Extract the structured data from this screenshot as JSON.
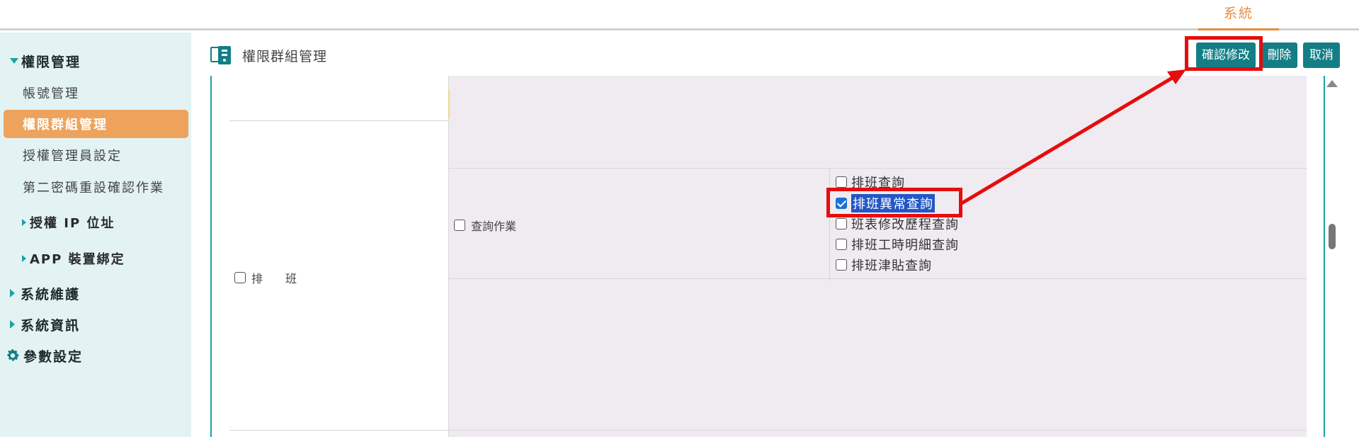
{
  "topbar": {
    "tab_label": "系統"
  },
  "sidebar": {
    "items": [
      {
        "label": "權限管理"
      },
      {
        "label": "帳號管理"
      },
      {
        "label": "權限群組管理"
      },
      {
        "label": "授權管理員設定"
      },
      {
        "label": "第二密碼重設確認作業"
      },
      {
        "label": "授權 IP 位址"
      },
      {
        "label": "APP 裝置綁定"
      },
      {
        "label": "系統維護"
      },
      {
        "label": "系統資訊"
      },
      {
        "label": "參數設定"
      }
    ]
  },
  "header": {
    "title": "權限群組管理",
    "confirm_label": "確認修改",
    "delete_label": "刪除",
    "cancel_label": "取消"
  },
  "table": {
    "group_label": "排　　班",
    "function_label": "查詢作業",
    "options": [
      {
        "label": "排班查詢",
        "checked": false
      },
      {
        "label": "排班異常查詢",
        "checked": true
      },
      {
        "label": "班表修改歷程查詢",
        "checked": false
      },
      {
        "label": "排班工時明細查詢",
        "checked": false
      },
      {
        "label": "排班津貼查詢",
        "checked": false
      }
    ]
  },
  "colors": {
    "accent": "#137e85",
    "active": "#eda35c",
    "annotation": "#e50d0d",
    "tab": "#e88a3a"
  },
  "icons": [
    "chevron-down-icon",
    "chevron-right-icon",
    "gear-icon",
    "page-icon",
    "scroll-up-icon"
  ]
}
